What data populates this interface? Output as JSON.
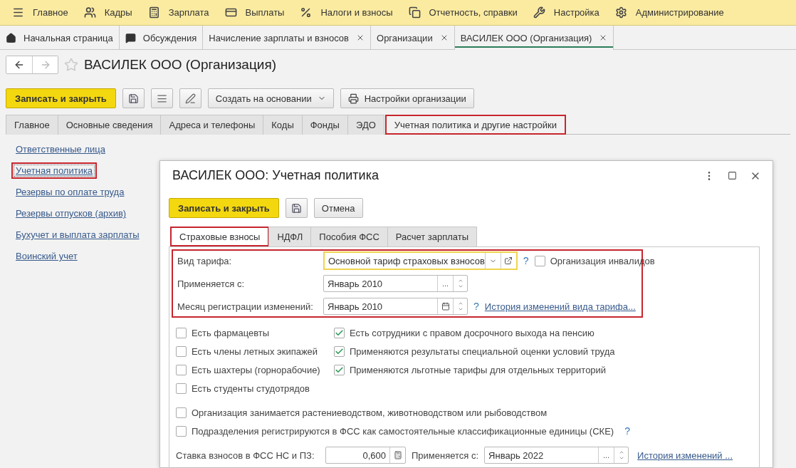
{
  "menu_bar": [
    {
      "label": "Главное",
      "kind": "menu"
    },
    {
      "label": "Кадры",
      "kind": "people"
    },
    {
      "label": "Зарплата",
      "kind": "calculator"
    },
    {
      "label": "Выплаты",
      "kind": "card"
    },
    {
      "label": "Налоги и взносы",
      "kind": "percent"
    },
    {
      "label": "Отчетность, справки",
      "kind": "documents"
    },
    {
      "label": "Настройка",
      "kind": "wrench"
    },
    {
      "label": "Администрирование",
      "kind": "gear"
    }
  ],
  "open_tabs": [
    {
      "label": "Начальная страница",
      "kind": "home",
      "closable": false,
      "selected": false
    },
    {
      "label": "Обсуждения",
      "kind": "chat",
      "closable": false,
      "selected": false
    },
    {
      "label": "Начисление зарплаты и взносов",
      "kind": "plain",
      "closable": true,
      "selected": false
    },
    {
      "label": "Организации",
      "kind": "plain",
      "closable": true,
      "selected": false
    },
    {
      "label": "ВАСИЛЕК ООО (Организация)",
      "kind": "plain",
      "closable": true,
      "selected": true
    }
  ],
  "page": {
    "title": "ВАСИЛЕК ООО (Организация)",
    "toolbar": {
      "primary": "Записать и закрыть",
      "create_based": "Создать на основании",
      "org_settings": "Настройки организации"
    },
    "tabs": [
      {
        "label": "Главное",
        "selected": false,
        "highlighted": false
      },
      {
        "label": "Основные сведения",
        "selected": false,
        "highlighted": false
      },
      {
        "label": "Адреса и телефоны",
        "selected": false,
        "highlighted": false
      },
      {
        "label": "Коды",
        "selected": false,
        "highlighted": false
      },
      {
        "label": "Фонды",
        "selected": false,
        "highlighted": false
      },
      {
        "label": "ЭДО",
        "selected": false,
        "highlighted": false
      },
      {
        "label": "Учетная политика и другие настройки",
        "selected": true,
        "highlighted": true
      }
    ],
    "side_links": [
      {
        "label": "Ответственные лица",
        "focused": false,
        "highlighted": false
      },
      {
        "label": "Учетная политика",
        "focused": true,
        "highlighted": true
      },
      {
        "label": "Резервы по оплате труда",
        "focused": false,
        "highlighted": false
      },
      {
        "label": "Резервы отпусков (архив)",
        "focused": false,
        "highlighted": false
      },
      {
        "label": "Бухучет и выплата зарплаты",
        "focused": false,
        "highlighted": false
      },
      {
        "label": "Воинский учет",
        "focused": false,
        "highlighted": false
      }
    ]
  },
  "dialog": {
    "title": "ВАСИЛЕК ООО: Учетная политика",
    "primary": "Записать и закрыть",
    "cancel": "Отмена",
    "tabs": [
      {
        "label": "Страховые взносы",
        "selected": true,
        "highlighted": true
      },
      {
        "label": "НДФЛ",
        "selected": false,
        "highlighted": false
      },
      {
        "label": "Пособия ФСС",
        "selected": false,
        "highlighted": false
      },
      {
        "label": "Расчет зарплаты",
        "selected": false,
        "highlighted": false
      }
    ],
    "tariff_section": {
      "highlighted": true,
      "tariff_label": "Вид тарифа:",
      "tariff_value": "Основной тариф страховых взносов",
      "tariff_focused": true,
      "tariff_help": "?",
      "disabled_org": {
        "label": "Организация инвалидов",
        "checked": false
      },
      "applies_label": "Применяется с:",
      "applies_value": "Январь 2010",
      "applies_select": "...",
      "month_label": "Месяц регистрации изменений:",
      "month_value": "Январь 2010",
      "month_help": "?",
      "history_link": "История изменений вида тарифа..."
    },
    "checkboxes": [
      {
        "label": "Есть фармацевты",
        "checked": false
      },
      {
        "label": "Есть сотрудники с правом досрочного выхода на пенсию",
        "checked": true
      },
      {
        "label": "Есть члены летных экипажей",
        "checked": false
      },
      {
        "label": "Применяются результаты специальной оценки условий труда",
        "checked": true
      },
      {
        "label": "Есть шахтеры (горнорабочие)",
        "checked": false
      },
      {
        "label": "Применяются льготные тарифы для отдельных территорий",
        "checked": true
      },
      {
        "label": "Есть студенты студотрядов",
        "checked": false
      }
    ],
    "wide_checkboxes": [
      {
        "label": "Организация занимается растениеводством, животноводством или рыбоводством",
        "checked": false
      },
      {
        "label": "Подразделения регистрируются в ФСС как самостоятельные классификационные единицы (СКЕ)",
        "checked": false,
        "help": "?"
      }
    ],
    "rate_row": {
      "label": "Ставка взносов в ФСС НС и ПЗ:",
      "value": "0,600",
      "applies_label": "Применяется с:",
      "applies_value": "Январь 2022",
      "applies_select": "...",
      "history_link": "История изменений ..."
    }
  }
}
